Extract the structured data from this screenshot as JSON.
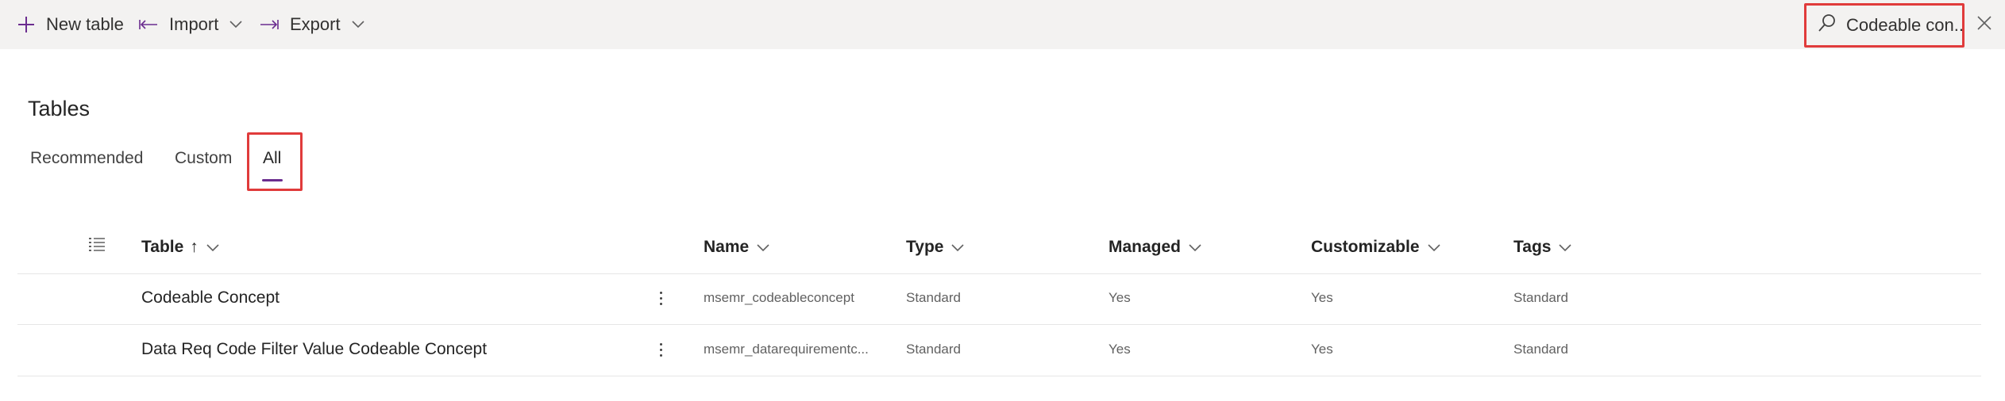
{
  "toolbar": {
    "new_table_label": "New table",
    "import_label": "Import",
    "export_label": "Export"
  },
  "search": {
    "value": "Codeable con..."
  },
  "page": {
    "title": "Tables"
  },
  "tabs": [
    {
      "label": "Recommended",
      "selected": false
    },
    {
      "label": "Custom",
      "selected": false
    },
    {
      "label": "All",
      "selected": true
    }
  ],
  "table": {
    "headers": {
      "table": "Table",
      "sort_indicator": "↑",
      "name": "Name",
      "type": "Type",
      "managed": "Managed",
      "customizable": "Customizable",
      "tags": "Tags"
    },
    "rows": [
      {
        "table": "Codeable Concept",
        "name": "msemr_codeableconcept",
        "type": "Standard",
        "managed": "Yes",
        "customizable": "Yes",
        "tags": "Standard"
      },
      {
        "table": "Data Req Code Filter Value Codeable Concept",
        "name": "msemr_datarequirementc...",
        "type": "Standard",
        "managed": "Yes",
        "customizable": "Yes",
        "tags": "Standard"
      }
    ]
  },
  "colors": {
    "accent": "#6b2d8f",
    "highlight_border": "#e03b3b",
    "command_bar_bg": "#f3f2f1"
  },
  "icons": [
    "plus-icon",
    "import-arrow-icon",
    "export-arrow-icon",
    "chevron-down-icon",
    "search-icon",
    "close-icon",
    "column-options-icon",
    "more-vertical-icon"
  ]
}
